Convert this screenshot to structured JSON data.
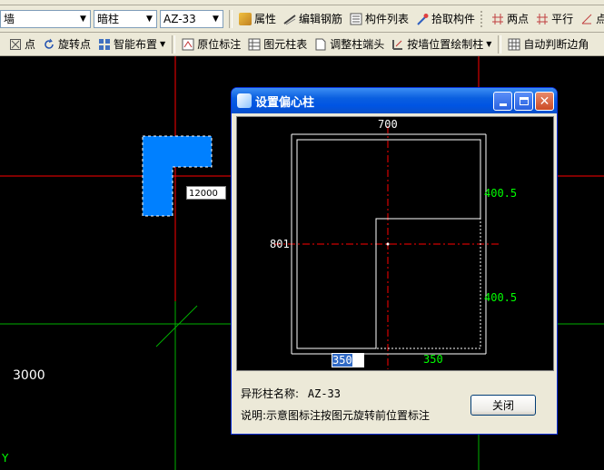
{
  "toolbar1": {
    "combo_type": "墙",
    "combo_subtype": "暗柱",
    "combo_name": "AZ-33",
    "btn_property": "属性",
    "btn_edit_rebar": "编辑钢筋",
    "btn_component_list": "构件列表",
    "btn_pick": "拾取构件",
    "btn_two_point": "两点",
    "btn_parallel": "平行",
    "btn_point_angle": "点角"
  },
  "toolbar2": {
    "btn_point": "点",
    "btn_rotate_point": "旋转点",
    "btn_smart_layout": "智能布置",
    "btn_in_place_label": "原位标注",
    "btn_column_table": "图元柱表",
    "btn_adjust_head": "调整柱端头",
    "btn_draw_by_wall": "按墙位置绘制柱",
    "btn_auto_judge": "自动判断边角"
  },
  "canvas": {
    "dim_input_value": "12000",
    "axis_label": "3000",
    "y_axis_label": "Y"
  },
  "dialog": {
    "title": "设置偏心柱",
    "dim_top": "700",
    "dim_left": "801",
    "dim_right_top": "400.5",
    "dim_right_bottom": "400.5",
    "dim_bottom_left": "350",
    "dim_bottom_right": "350",
    "name_label": "异形柱名称:",
    "name_value": "AZ-33",
    "note": "说明:示意图标注按图元旋转前位置标注",
    "close_label": "关闭"
  },
  "colors": {
    "canvas_bg": "#000000",
    "grid_red": "#ff0000",
    "grid_green": "#00c000",
    "column_blue": "#0080ff",
    "dim_green": "#00ff00"
  }
}
